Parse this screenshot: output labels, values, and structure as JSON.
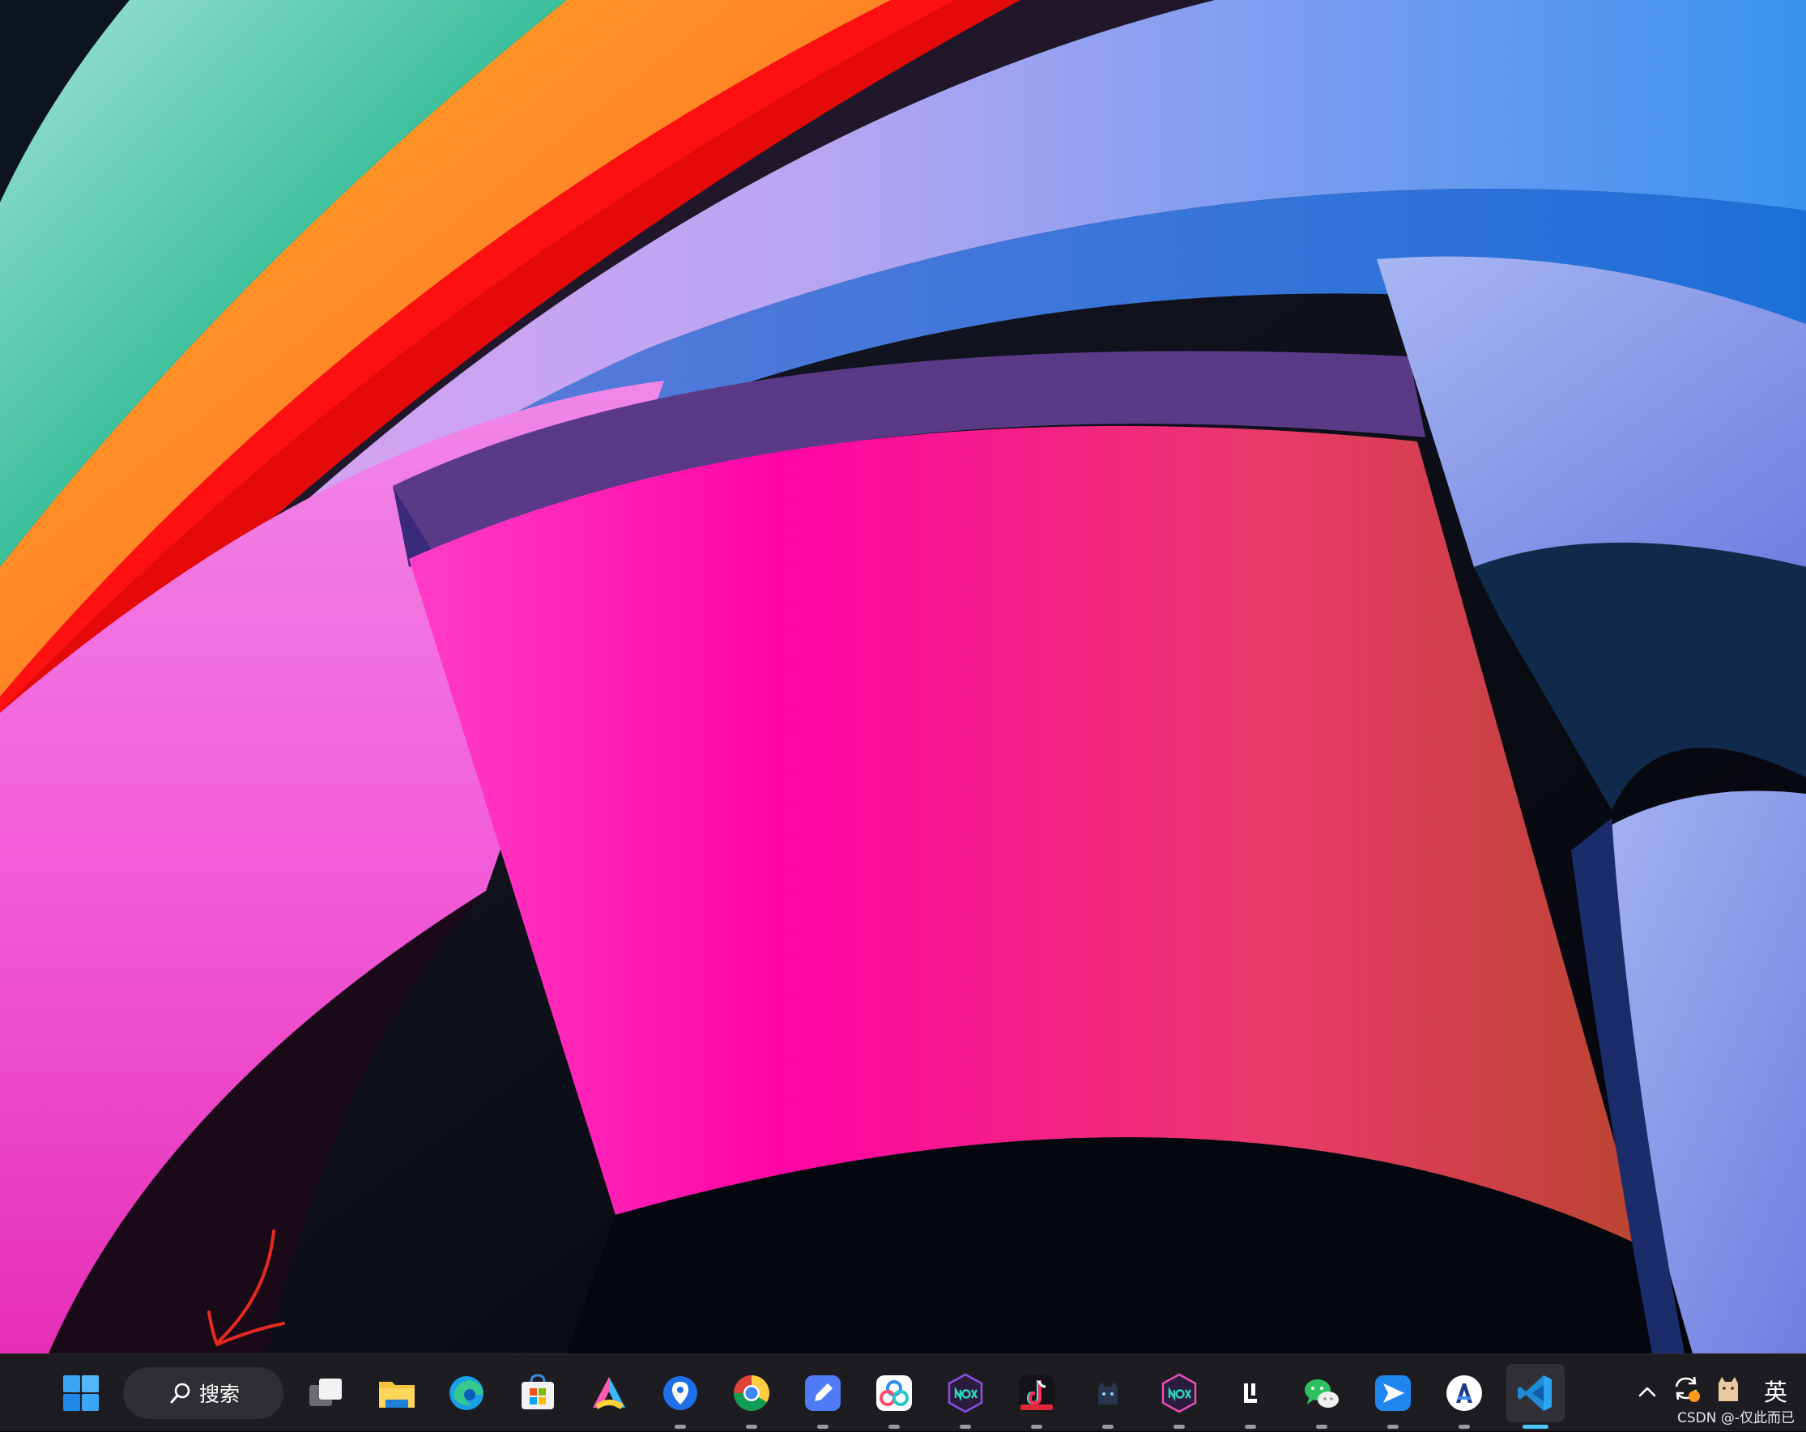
{
  "wallpaper": {
    "description_colors": [
      "#00c49a",
      "#ff7a1a",
      "#ff0a0a",
      "#ff4ad9",
      "#b89cf5",
      "#2c8ff0",
      "#ff1aa0",
      "#7c8ff0"
    ]
  },
  "annotation": {
    "color": "#e52a1e"
  },
  "taskbar": {
    "background": "#1d1d21",
    "start": {
      "icon": "windows-start-icon"
    },
    "search": {
      "label": "搜索",
      "icon": "search-icon"
    },
    "apps": [
      {
        "name": "task-view",
        "icon": "task-view-icon",
        "running": false,
        "active": false
      },
      {
        "name": "file-explorer",
        "icon": "folder-icon",
        "running": false,
        "active": false
      },
      {
        "name": "edge",
        "icon": "edge-icon",
        "running": false,
        "active": false
      },
      {
        "name": "microsoft-store",
        "icon": "store-icon",
        "running": false,
        "active": false
      },
      {
        "name": "arc-app",
        "icon": "triangle-app-icon",
        "running": false,
        "active": false
      },
      {
        "name": "location-app",
        "icon": "map-pin-icon",
        "running": true,
        "active": false
      },
      {
        "name": "chrome",
        "icon": "chrome-icon",
        "running": true,
        "active": false
      },
      {
        "name": "note-app",
        "icon": "pen-note-icon",
        "running": true,
        "active": false
      },
      {
        "name": "baidu-netdisk",
        "icon": "cloud-icon",
        "running": true,
        "active": false
      },
      {
        "name": "nox-player",
        "icon": "nox-icon",
        "running": true,
        "active": false
      },
      {
        "name": "tiktok-live",
        "icon": "tiktok-icon",
        "running": true,
        "active": false
      },
      {
        "name": "cat-app",
        "icon": "cat-icon",
        "running": true,
        "active": false
      },
      {
        "name": "nox-multi",
        "icon": "nox-icon",
        "running": true,
        "active": false
      },
      {
        "name": "l-app",
        "icon": "l-letter-icon",
        "running": true,
        "active": false
      },
      {
        "name": "wechat",
        "icon": "wechat-icon",
        "running": true,
        "active": false
      },
      {
        "name": "feishu",
        "icon": "paper-plane-icon",
        "running": true,
        "active": false
      },
      {
        "name": "typora",
        "icon": "typora-icon",
        "running": true,
        "active": false
      },
      {
        "name": "vscode",
        "icon": "vscode-icon",
        "running": true,
        "active": true
      }
    ],
    "tray": {
      "chevron": "chevron-up-icon",
      "sync": "sync-icon",
      "pet": "cat-pet-icon",
      "ime_label": "英"
    }
  },
  "watermark": "CSDN @-仅此而已"
}
